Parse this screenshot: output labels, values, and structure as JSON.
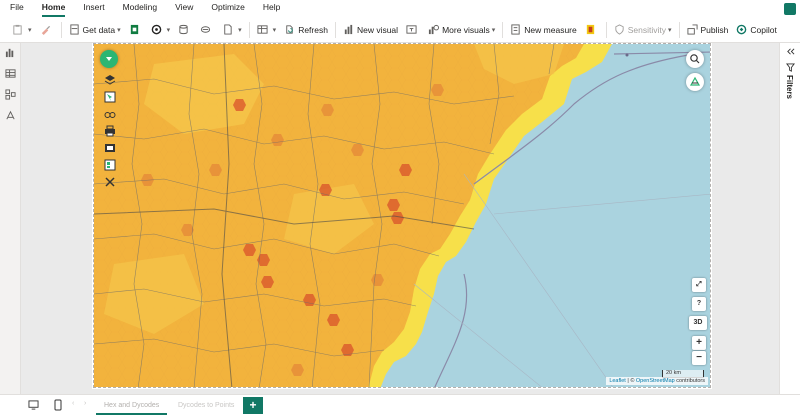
{
  "menu": {
    "items": [
      "File",
      "Home",
      "Insert",
      "Modeling",
      "View",
      "Optimize",
      "Help"
    ],
    "active": "Home"
  },
  "ribbon": {
    "get_data": "Get data",
    "refresh": "Refresh",
    "new_visual": "New visual",
    "more_visuals": "More visuals",
    "new_measure": "New measure",
    "sensitivity": "Sensitivity",
    "publish": "Publish",
    "copilot": "Copilot"
  },
  "filters": {
    "label": "Filters"
  },
  "map": {
    "attribution_leaflet": "Leaflet",
    "attribution_sep": " | © ",
    "attribution_osm": "OpenStreetMap",
    "attribution_tail": " contributors",
    "scale": "20 km",
    "controls": {
      "expand": "⤢",
      "help": "?",
      "mode3d": "3D",
      "zoom_in": "+",
      "zoom_out": "−"
    }
  },
  "tabs": {
    "tab1": "Hex and Dycodes",
    "tab2": "Dycodes to Points",
    "add": "+"
  },
  "colors": {
    "accent": "#117865",
    "water": "#aad3df",
    "hex_light": "#f7e04a",
    "hex_mid": "#f2b33d",
    "hex_dark": "#d9532b"
  }
}
